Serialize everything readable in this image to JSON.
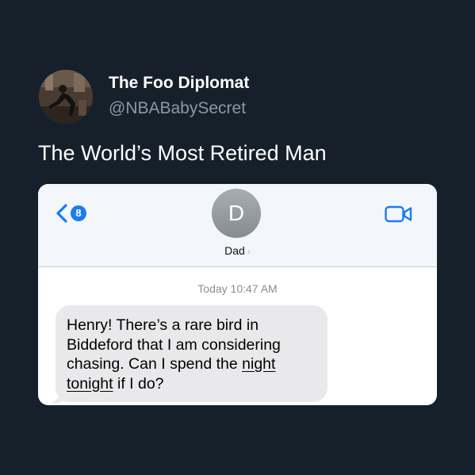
{
  "tweet": {
    "display_name": "The Foo Diplomat",
    "handle": "@NBABabySecret",
    "text": "The World’s Most Retired Man"
  },
  "screenshot": {
    "header": {
      "back_badge_count": "8",
      "contact_initial": "D",
      "contact_name": "Dad",
      "contact_chevron": "›",
      "icons": [
        "back-chevron-icon",
        "video-call-icon",
        "chevron-right-icon"
      ]
    },
    "timestamp": {
      "day": "Today",
      "time": "10:47 AM"
    },
    "message": {
      "line1": "Henry!  There’s a rare bird in",
      "line2": "Biddeford that I am considering",
      "line3_pre": "chasing. Can I spend the ",
      "line3_link": "night",
      "line4_link": "tonight",
      "line4_post": " if I do?"
    }
  },
  "colors": {
    "page_background": "#15202b",
    "handle_gray": "#8b98a5",
    "ios_blue": "#1a7cf5",
    "bubble_gray": "#e9e9eb",
    "contact_avatar_gray": "#9a9ea5"
  }
}
